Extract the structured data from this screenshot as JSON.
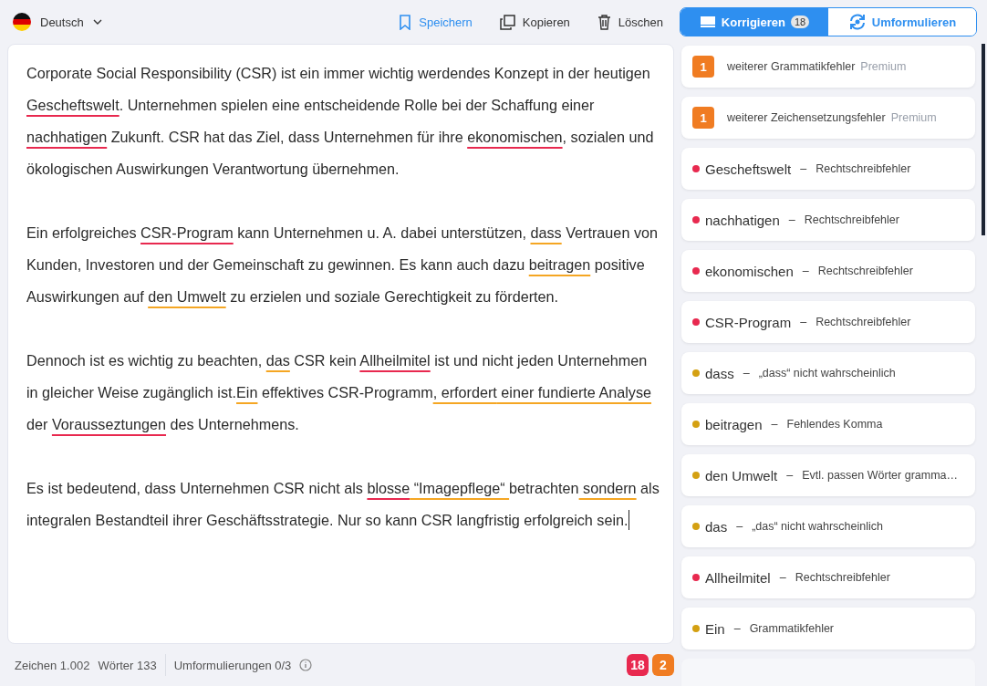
{
  "language": {
    "label": "Deutsch"
  },
  "actions": [
    {
      "kind": "save",
      "label": "Speichern"
    },
    {
      "kind": "copy",
      "label": "Kopieren"
    },
    {
      "kind": "delete",
      "label": "Löschen"
    }
  ],
  "modes": [
    {
      "kind": "correct",
      "label": "Korrigieren",
      "count": "18",
      "selected": true
    },
    {
      "kind": "rephrase",
      "label": "Umformulieren",
      "selected": false
    }
  ],
  "paragraphs": [
    [
      {
        "text": "Corporate Social Responsibility (CSR) ist ein immer wichtig werdendes Konzept in der heutigen ",
        "kind": "plain"
      },
      {
        "text": "Gescheftswelt",
        "kind": "spelling"
      },
      {
        "text": ". Unternehmen spielen eine entscheidende Rolle bei der Schaffung einer ",
        "kind": "plain"
      },
      {
        "text": "nachhatigen",
        "kind": "spelling"
      },
      {
        "text": " Zukunft. CSR hat das Ziel, dass Unternehmen für ihre ",
        "kind": "plain"
      },
      {
        "text": "ekonomischen",
        "kind": "spelling"
      },
      {
        "text": ", sozialen und ökologischen Auswirkungen Verantwortung übernehmen.",
        "kind": "plain"
      }
    ],
    [
      {
        "text": "Ein erfolgreiches ",
        "kind": "plain"
      },
      {
        "text": "CSR-Program",
        "kind": "spelling"
      },
      {
        "text": " kann Unternehmen u. A. dabei unterstützen, ",
        "kind": "plain"
      },
      {
        "text": "dass",
        "kind": "grammar"
      },
      {
        "text": " Vertrauen von Kunden, Investoren und der Gemeinschaft zu gewinnen. Es kann auch dazu ",
        "kind": "plain"
      },
      {
        "text": "beitragen",
        "kind": "grammar"
      },
      {
        "text": " positive Auswirkungen auf ",
        "kind": "plain"
      },
      {
        "text": "den Umwelt",
        "kind": "grammar"
      },
      {
        "text": " zu erzielen und soziale Gerechtigkeit zu förderten.",
        "kind": "plain"
      }
    ],
    [
      {
        "text": "Dennoch ist es wichtig zu beachten, ",
        "kind": "plain"
      },
      {
        "text": "das",
        "kind": "grammar"
      },
      {
        "text": " CSR kein ",
        "kind": "plain"
      },
      {
        "text": "Allheilmitel",
        "kind": "spelling"
      },
      {
        "text": " ist und nicht jeden Unternehmen in gleicher Weise zugänglich ist.",
        "kind": "plain"
      },
      {
        "text": "Ein",
        "kind": "grammar"
      },
      {
        "text": " effektives CSR-Programm",
        "kind": "plain"
      },
      {
        "text": ", erfordert",
        "kind": "grammar"
      },
      {
        "text": " einer fundierte Analyse",
        "kind": "grammar"
      },
      {
        "text": " der ",
        "kind": "plain"
      },
      {
        "text": "Vorausseztungen",
        "kind": "spelling"
      },
      {
        "text": " des Unternehmens.",
        "kind": "plain"
      }
    ],
    [
      {
        "text": "Es ist bedeutend, dass Unternehmen CSR nicht als ",
        "kind": "plain"
      },
      {
        "text": "blosse",
        "kind": "spelling"
      },
      {
        "text": " “Imagepflege“ ",
        "kind": "grammar"
      },
      {
        "text": "betrachten",
        "kind": "plain"
      },
      {
        "text": " sondern",
        "kind": "grammar"
      },
      {
        "text": " als integralen Bestandteil ihrer Geschäftsstrategie. Nur so kann CSR langfristig erfolgreich sein.",
        "kind": "plain"
      }
    ]
  ],
  "issues": [
    {
      "kind": "premium",
      "count": "1",
      "text": "weiterer Grammatikfehler",
      "tag": "Premium"
    },
    {
      "kind": "premium",
      "count": "1",
      "text": "weiterer Zeichensetzungsfehler",
      "tag": "Premium"
    },
    {
      "kind": "error",
      "word": "Gescheftswelt",
      "separator": "–",
      "description": "Rechtschreibfehler",
      "color": "#e8294f"
    },
    {
      "kind": "error",
      "word": "nachhatigen",
      "separator": "–",
      "description": "Rechtschreibfehler",
      "color": "#e8294f"
    },
    {
      "kind": "error",
      "word": "ekonomischen",
      "separator": "–",
      "description": "Rechtschreibfehler",
      "color": "#e8294f"
    },
    {
      "kind": "error",
      "word": "CSR-Program",
      "separator": "–",
      "description": "Rechtschreibfehler",
      "color": "#e8294f"
    },
    {
      "kind": "error",
      "word": "dass",
      "separator": "–",
      "description": "„dass“ nicht wahrscheinlich",
      "color": "#d4a012"
    },
    {
      "kind": "error",
      "word": "beitragen",
      "separator": "–",
      "description": "Fehlendes Komma",
      "color": "#d4a012"
    },
    {
      "kind": "error",
      "word": "den Umwelt",
      "separator": "–",
      "description": "Evtl. passen Wörter gramma…",
      "color": "#d4a012"
    },
    {
      "kind": "error",
      "word": "das",
      "separator": "–",
      "description": "„das“ nicht wahrscheinlich",
      "color": "#d4a012"
    },
    {
      "kind": "error",
      "word": "Allheilmitel",
      "separator": "–",
      "description": "Rechtschreibfehler",
      "color": "#e8294f"
    },
    {
      "kind": "error",
      "word": "Ein",
      "separator": "–",
      "description": "Grammatikfehler",
      "color": "#d4a012"
    }
  ],
  "status_bar": {
    "characters": "Zeichen 1.002",
    "words": "Wörter 133",
    "rephrasings": "Umformulierungen 0/3",
    "badges": [
      {
        "text": "18",
        "color": "#e8294f"
      },
      {
        "text": "2",
        "color": "#f07c22"
      }
    ]
  }
}
